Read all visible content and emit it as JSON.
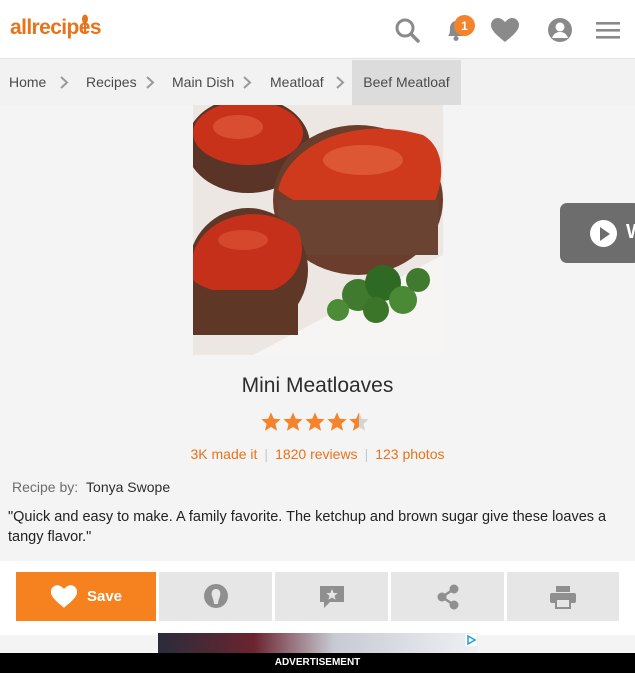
{
  "header": {
    "logo": "allrecipes",
    "notification_count": "1"
  },
  "breadcrumb": [
    {
      "label": "Home"
    },
    {
      "label": "Recipes"
    },
    {
      "label": "Main Dish"
    },
    {
      "label": "Meatloaf"
    },
    {
      "label": "Beef Meatloaf"
    }
  ],
  "recipe": {
    "title": "Mini Meatloaves",
    "rating": 4.5,
    "made_it": "3K made it",
    "reviews": "1820 reviews",
    "photos": "123 photos",
    "recipe_by_label": "Recipe by:",
    "author": "Tonya Swope",
    "description": "\"Quick and easy to make. A family favorite. The ketchup and brown sugar give these loaves a tangy flavor.\""
  },
  "video": {
    "label": "W"
  },
  "actions": {
    "save_label": "Save"
  },
  "ad": {
    "label": "ADVERTISEMENT"
  },
  "colors": {
    "brand": "#e8731a",
    "save_button": "#f5811f",
    "star": "#f4832c"
  }
}
